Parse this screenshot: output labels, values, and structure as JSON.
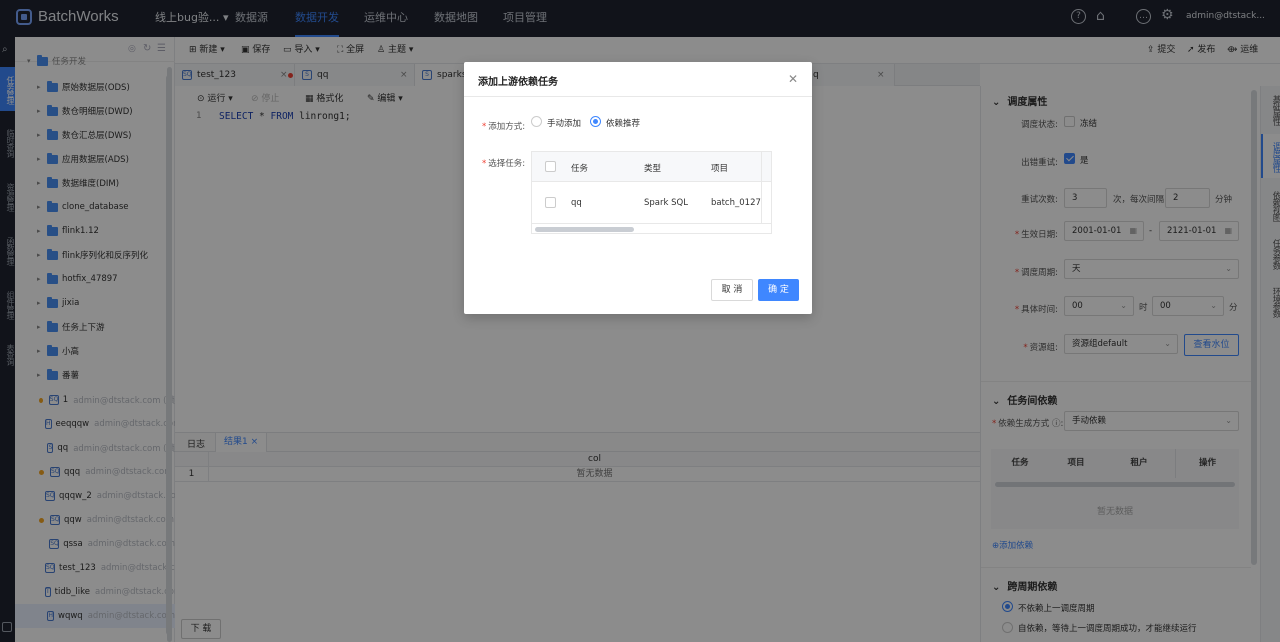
{
  "app": {
    "title": "BatchWorks",
    "project": "线上bug验...",
    "user": "admin@dtstack..."
  },
  "nav": [
    {
      "label": "数据源"
    },
    {
      "label": "数据开发"
    },
    {
      "label": "运维中心"
    },
    {
      "label": "数据地图"
    },
    {
      "label": "项目管理"
    }
  ],
  "rail": [
    {
      "label": "任务管理"
    },
    {
      "label": "临时查询"
    },
    {
      "label": "资源管理"
    },
    {
      "label": "函数管理"
    },
    {
      "label": "组件管理"
    },
    {
      "label": "表查询"
    }
  ],
  "tree": {
    "root": "任务开发",
    "folders": [
      {
        "name": "原始数据层(ODS)"
      },
      {
        "name": "数仓明细层(DWD)"
      },
      {
        "name": "数仓汇总层(DWS)"
      },
      {
        "name": "应用数据层(ADS)"
      },
      {
        "name": "数据维度(DIM)"
      },
      {
        "name": "clone_database"
      },
      {
        "name": "flink1.12"
      },
      {
        "name": "flink序列化和反序列化"
      },
      {
        "name": "hotfix_47897"
      },
      {
        "name": "jixia"
      },
      {
        "name": "任务上下游"
      },
      {
        "name": "小高"
      },
      {
        "name": "番薯"
      }
    ],
    "files": [
      {
        "icon": "SQ",
        "name": "1",
        "owner": "admin@dtstack.com (锁"
      },
      {
        "icon": "H",
        "name": "eeqqqw",
        "owner": "admin@dtstack.com"
      },
      {
        "icon": "S",
        "name": "qq",
        "owner": "admin@dtstack.com (锁"
      },
      {
        "icon": "SQ",
        "name": "qqq",
        "owner": "admin@dtstack.com"
      },
      {
        "icon": "SQ",
        "name": "qqqw_2",
        "owner": "admin@dtstack.com"
      },
      {
        "icon": "SQ",
        "name": "qqw",
        "owner": "admin@dtstack.com"
      },
      {
        "icon": "SQ",
        "name": "qssa",
        "owner": "admin@dtstack.com"
      },
      {
        "icon": "SQ",
        "name": "test_123",
        "owner": "admin@dtstack.com"
      },
      {
        "icon": "T",
        "name": "tidb_like",
        "owner": "admin@dtstack.com"
      },
      {
        "icon": "H",
        "name": "wqwq",
        "owner": "admin@dtstack.com"
      }
    ]
  },
  "toolbar": {
    "new": "新建",
    "save": "保存",
    "import": "导入",
    "fullscreen": "全屏",
    "theme": "主题",
    "submit": "提交",
    "publish": "发布",
    "ops": "运维"
  },
  "tabs": [
    {
      "label": "test_123"
    },
    {
      "label": "qq"
    },
    {
      "label": "sparksq"
    },
    {
      "label": "q"
    }
  ],
  "editor": {
    "run": "运行",
    "stop": "停止",
    "format": "格式化",
    "edit": "编辑",
    "line": "1",
    "code_kw1": "SELECT",
    "code_mid": " * ",
    "code_kw2": "FROM",
    "code_rest": " linrong1;"
  },
  "results": {
    "tab_log": "日志",
    "tab_result": "结果1",
    "col": "col",
    "rowno": "1",
    "empty": "暂无数据",
    "download": "下 载"
  },
  "right": {
    "tabs": [
      {
        "label": "基础属性"
      },
      {
        "label": "调度属性"
      },
      {
        "label": "依赖视图"
      },
      {
        "label": "任务参数"
      },
      {
        "label": "环境参数"
      }
    ],
    "sched_title": "调度属性",
    "status_label": "调度状态:",
    "status_val": "冻结",
    "retry_label": "出错重试:",
    "retry_val": "是",
    "retry_count_label": "重试次数:",
    "retry_count": "3",
    "retry_mid": "次，每次间隔",
    "retry_interval": "2",
    "retry_unit": "分钟",
    "date_label": "生效日期:",
    "date_start": "2001-01-01",
    "date_sep": "-",
    "date_end": "2121-01-01",
    "cycle_label": "调度周期:",
    "cycle_val": "天",
    "time_label": "具体时间:",
    "hour": "00",
    "hour_unit": "时",
    "minute": "00",
    "minute_unit": "分",
    "res_label": "资源组:",
    "res_val": "资源组default",
    "res_btn": "查看水位",
    "dep_title": "任务间依赖",
    "dep_mode_label": "依赖生成方式",
    "dep_mode_val": "手动依赖",
    "dep_cols": [
      "任务",
      "项目",
      "租户",
      "操作"
    ],
    "dep_empty": "暂无数据",
    "dep_add": "添加依赖",
    "cross_title": "跨周期依赖",
    "cross_opt1": "不依赖上一调度周期",
    "cross_opt2": "自依赖，等待上一调度周期成功，才能继续运行"
  },
  "modal": {
    "title": "添加上游依赖任务",
    "add_label": "添加方式:",
    "opt_manual": "手动添加",
    "opt_recommend": "依赖推荐",
    "select_label": "选择任务:",
    "cols": [
      "任务",
      "类型",
      "项目"
    ],
    "rows": [
      {
        "task": "qq",
        "type": "Spark SQL",
        "project": "batch_0127"
      }
    ],
    "cancel": "取 消",
    "ok": "确 定"
  }
}
